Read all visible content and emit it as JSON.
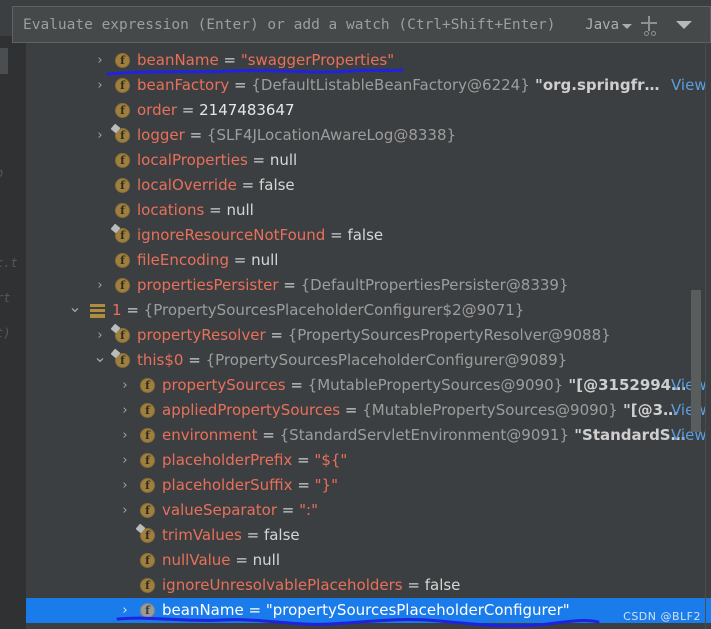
{
  "toolbar": {
    "expression_placeholder": "Evaluate expression (Enter) or add a watch (Ctrl+Shift+Enter)",
    "language": "Java",
    "language_caret_icon": "chevron-down-icon",
    "add_watch_icon": "add-watch-plus-icon",
    "more_icon": "chevron-down-icon"
  },
  "editor_bg_text": [
    "b",
    "c.t",
    "rt",
    "t)"
  ],
  "watermark": "CSDN @BLF2",
  "colors": {
    "background": "#3c3f41",
    "selection": "#1a7beb",
    "field_name": "#e8705a",
    "reference": "#9d9d9d",
    "link": "#5a9ee0",
    "annotation": "#1f22e0"
  },
  "tree": {
    "rows": [
      {
        "indent": 1,
        "arrow": "collapsed",
        "icon": "field-icon",
        "name": "beanName",
        "eq": " = ",
        "value": "\"swaggerProperties\"",
        "value_kind": "string"
      },
      {
        "indent": 1,
        "arrow": "collapsed",
        "icon": "field-icon",
        "name": "beanFactory",
        "eq": " = ",
        "value": "{DefaultListableBeanFactory@6224}",
        "value_kind": "ref",
        "tail": "\"org.springfr…",
        "link": "View"
      },
      {
        "indent": 1,
        "arrow": "none",
        "icon": "field-icon",
        "name": "order",
        "eq": " = ",
        "value": "2147483647",
        "value_kind": "number"
      },
      {
        "indent": 1,
        "arrow": "collapsed",
        "icon": "field-icon-static",
        "name": "logger",
        "eq": " = ",
        "value": "{SLF4JLocationAwareLog@8338}",
        "value_kind": "ref"
      },
      {
        "indent": 1,
        "arrow": "none",
        "icon": "field-icon",
        "name": "localProperties",
        "eq": " = ",
        "value": "null",
        "value_kind": "keyword"
      },
      {
        "indent": 1,
        "arrow": "none",
        "icon": "field-icon",
        "name": "localOverride",
        "eq": " = ",
        "value": "false",
        "value_kind": "keyword"
      },
      {
        "indent": 1,
        "arrow": "none",
        "icon": "field-icon",
        "name": "locations",
        "eq": " = ",
        "value": "null",
        "value_kind": "keyword"
      },
      {
        "indent": 1,
        "arrow": "none",
        "icon": "field-icon-static",
        "name": "ignoreResourceNotFound",
        "eq": " = ",
        "value": "false",
        "value_kind": "keyword"
      },
      {
        "indent": 1,
        "arrow": "none",
        "icon": "field-icon",
        "name": "fileEncoding",
        "eq": " = ",
        "value": "null",
        "value_kind": "keyword"
      },
      {
        "indent": 1,
        "arrow": "collapsed",
        "icon": "field-icon",
        "name": "propertiesPersister",
        "eq": " = ",
        "value": "{DefaultPropertiesPersister@8339}",
        "value_kind": "ref"
      },
      {
        "indent": 0,
        "arrow": "expanded",
        "icon": "array-icon",
        "name": "1",
        "eq": " = ",
        "value": "{PropertySourcesPlaceholderConfigurer$2@9071}",
        "value_kind": "ref",
        "name_kind": "index"
      },
      {
        "indent": 1,
        "arrow": "collapsed",
        "icon": "field-icon-static",
        "name": "propertyResolver",
        "eq": " = ",
        "value": "{PropertySourcesPropertyResolver@9088}",
        "value_kind": "ref"
      },
      {
        "indent": 1,
        "arrow": "expanded",
        "icon": "field-icon-static",
        "name": "this$0",
        "eq": " = ",
        "value": "{PropertySourcesPlaceholderConfigurer@9089}",
        "value_kind": "ref"
      },
      {
        "indent": 2,
        "arrow": "collapsed",
        "icon": "field-icon",
        "name": "propertySources",
        "eq": " = ",
        "value": "{MutablePropertySources@9090}",
        "value_kind": "ref",
        "tail": "\"[@3152994…",
        "link": "View"
      },
      {
        "indent": 2,
        "arrow": "collapsed",
        "icon": "field-icon",
        "name": "appliedPropertySources",
        "eq": " = ",
        "value": "{MutablePropertySources@9090}",
        "value_kind": "ref",
        "tail": "\"[@3…",
        "link": "View"
      },
      {
        "indent": 2,
        "arrow": "collapsed",
        "icon": "field-icon",
        "name": "environment",
        "eq": " = ",
        "value": "{StandardServletEnvironment@9091}",
        "value_kind": "ref",
        "tail": "\"StandardS…",
        "link": "View"
      },
      {
        "indent": 2,
        "arrow": "collapsed",
        "icon": "field-icon",
        "name": "placeholderPrefix",
        "eq": " = ",
        "value": "\"${\"",
        "value_kind": "string"
      },
      {
        "indent": 2,
        "arrow": "collapsed",
        "icon": "field-icon",
        "name": "placeholderSuffix",
        "eq": " = ",
        "value": "\"}\"",
        "value_kind": "string"
      },
      {
        "indent": 2,
        "arrow": "collapsed",
        "icon": "field-icon",
        "name": "valueSeparator",
        "eq": " = ",
        "value": "\":\"",
        "value_kind": "string"
      },
      {
        "indent": 2,
        "arrow": "none",
        "icon": "field-icon-static",
        "name": "trimValues",
        "eq": " = ",
        "value": "false",
        "value_kind": "keyword"
      },
      {
        "indent": 2,
        "arrow": "none",
        "icon": "field-icon",
        "name": "nullValue",
        "eq": " = ",
        "value": "null",
        "value_kind": "keyword"
      },
      {
        "indent": 2,
        "arrow": "none",
        "icon": "field-icon",
        "name": "ignoreUnresolvablePlaceholders",
        "eq": " = ",
        "value": "false",
        "value_kind": "keyword"
      },
      {
        "indent": 2,
        "arrow": "collapsed",
        "icon": "field-icon",
        "name": "beanName",
        "eq": " = ",
        "value": "\"propertySourcesPlaceholderConfigurer\"",
        "value_kind": "string",
        "selected": true
      }
    ]
  }
}
